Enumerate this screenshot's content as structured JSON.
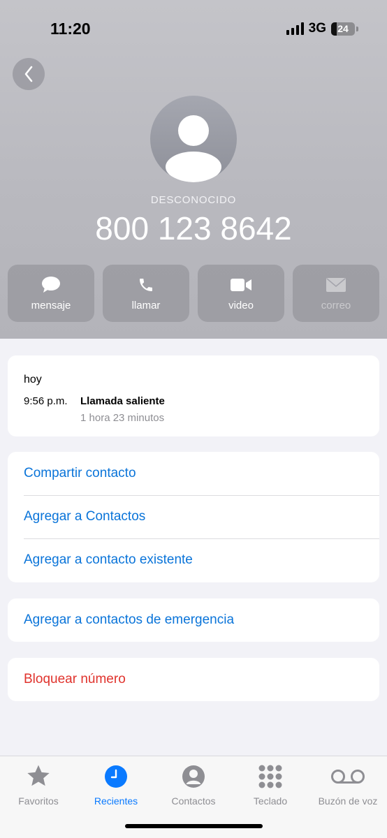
{
  "status_bar": {
    "time": "11:20",
    "network": "3G",
    "battery": "24",
    "battery_fraction": 0.24
  },
  "caller": {
    "label": "DESCONOCIDO",
    "number": "800 123 8642"
  },
  "actions": [
    {
      "label": "mensaje",
      "icon": "message-bubble-icon",
      "enabled": true
    },
    {
      "label": "llamar",
      "icon": "phone-icon",
      "enabled": true
    },
    {
      "label": "video",
      "icon": "video-camera-icon",
      "enabled": true
    },
    {
      "label": "correo",
      "icon": "envelope-icon",
      "enabled": false
    }
  ],
  "recent_call": {
    "day": "hoy",
    "time": "9:56 p.m.",
    "type": "Llamada saliente",
    "duration": "1 hora 23 minutos"
  },
  "contact_actions": [
    "Compartir contacto",
    "Agregar a Contactos",
    "Agregar a contacto existente"
  ],
  "emergency_action": "Agregar a contactos de emergencia",
  "block_action": "Bloquear número",
  "tabs": [
    {
      "label": "Favoritos",
      "icon": "star-icon",
      "active": false
    },
    {
      "label": "Recientes",
      "icon": "clock-icon",
      "active": true
    },
    {
      "label": "Contactos",
      "icon": "person-circle-icon",
      "active": false
    },
    {
      "label": "Teclado",
      "icon": "keypad-icon",
      "active": false
    },
    {
      "label": "Buzón de voz",
      "icon": "voicemail-icon",
      "active": false
    }
  ],
  "colors": {
    "link": "#0a74d9",
    "destructive": "#e0332d",
    "tab_active": "#0a7aff",
    "tab_inactive": "#8e8e93"
  }
}
